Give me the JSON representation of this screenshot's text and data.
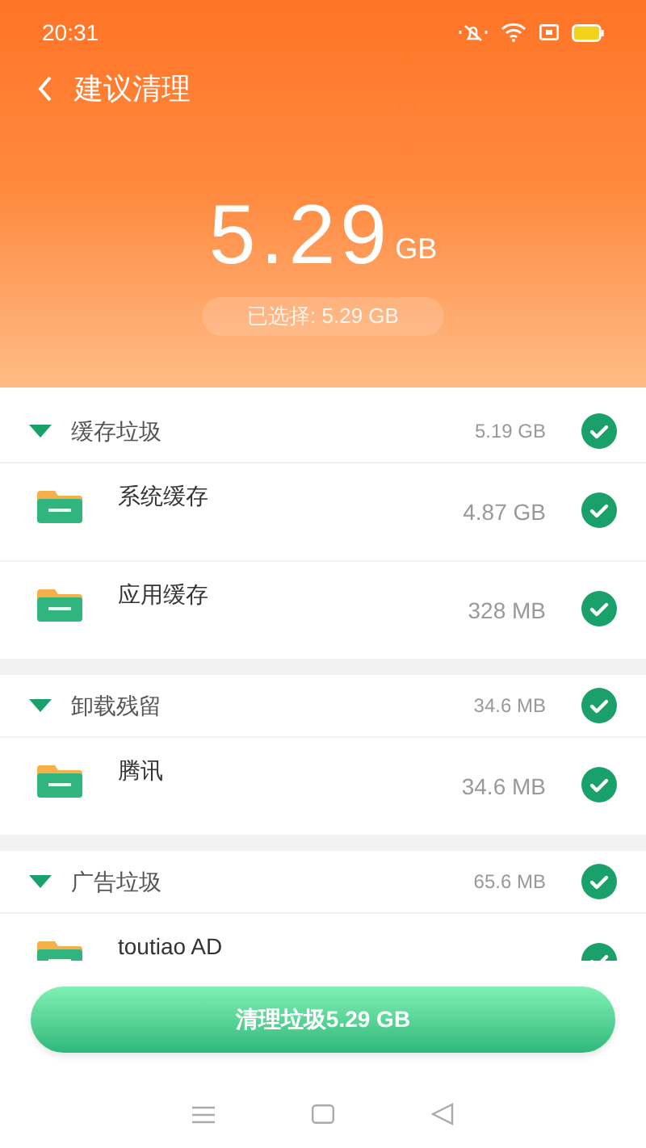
{
  "status_bar": {
    "time": "20:31"
  },
  "header": {
    "title": "建议清理",
    "total_value": "5.29",
    "total_unit": "GB",
    "selected_label": "已选择: 5.29 GB"
  },
  "sections": [
    {
      "name": "缓存垃圾",
      "size": "5.19 GB",
      "expanded": true,
      "checked": true,
      "items": [
        {
          "name": "系统缓存",
          "size": "4.87 GB",
          "checked": true
        },
        {
          "name": "应用缓存",
          "size": "328 MB",
          "checked": true
        }
      ]
    },
    {
      "name": "卸载残留",
      "size": "34.6 MB",
      "expanded": true,
      "checked": true,
      "items": [
        {
          "name": "腾讯",
          "size": "34.6 MB",
          "checked": true
        }
      ]
    },
    {
      "name": "广告垃圾",
      "size": "65.6 MB",
      "expanded": true,
      "checked": true,
      "items": [
        {
          "name": "toutiao AD",
          "checked": true
        }
      ]
    }
  ],
  "clean_button": "清理垃圾5.29 GB"
}
